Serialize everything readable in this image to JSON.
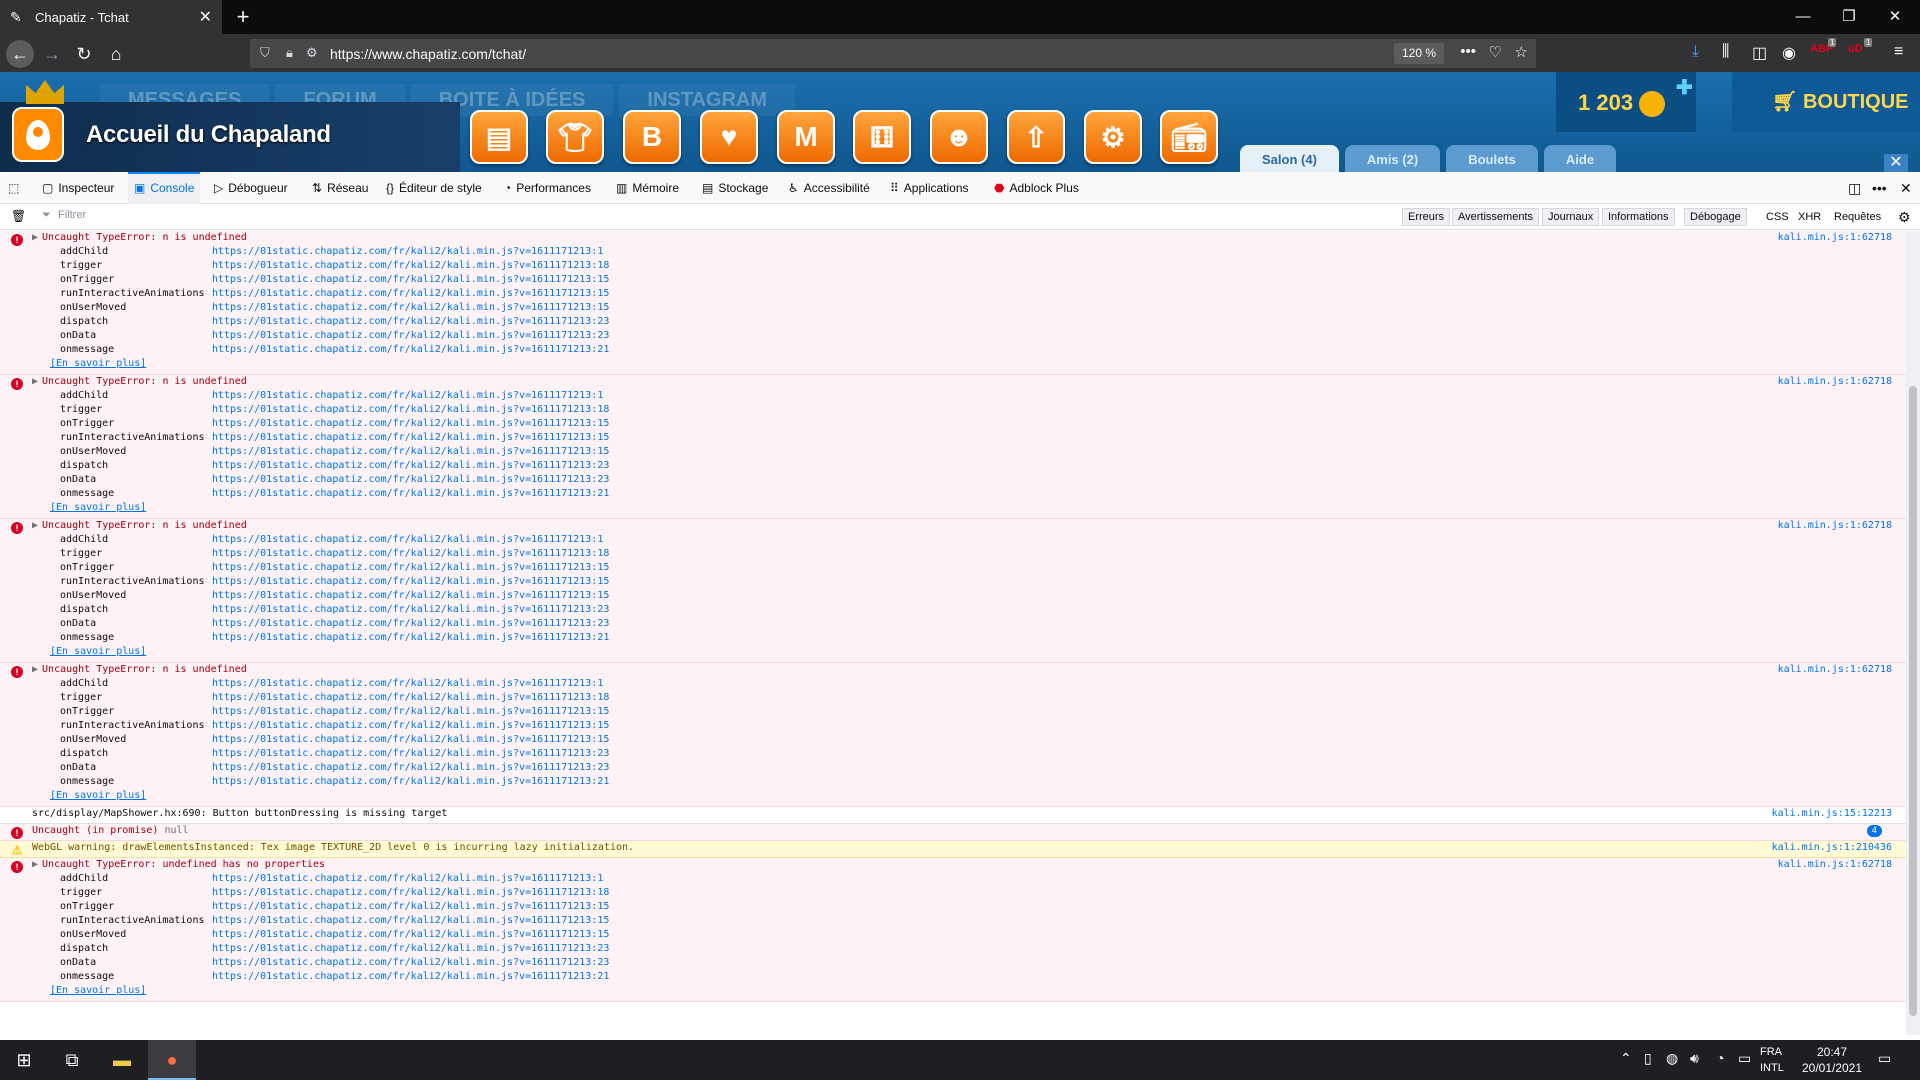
{
  "browser": {
    "tab_title": "Chapatiz - Tchat",
    "url": "https://www.chapatiz.com/tchat/",
    "zoom": "120 %",
    "abp_badge": "1",
    "ud_badge": "1"
  },
  "game": {
    "nav": [
      "MESSAGES",
      "FORUM",
      "BOITE À IDÉES",
      "INSTAGRAM"
    ],
    "home_title": "Accueil du Chapaland",
    "coins": "1 203",
    "shop": "BOUTIQUE",
    "tabs": [
      "Salon (4)",
      "Amis (2)",
      "Boulets",
      "Aide"
    ],
    "buttons": [
      "journal",
      "tshirt",
      "B",
      "heart-bubble",
      "M",
      "dice",
      "character",
      "up-arrow",
      "gear",
      "radio"
    ]
  },
  "devtools": {
    "tabs": [
      "Inspecteur",
      "Console",
      "Débogueur",
      "Réseau",
      "Éditeur de style",
      "Performances",
      "Mémoire",
      "Stockage",
      "Accessibilité",
      "Applications",
      "Adblock Plus"
    ],
    "filter_placeholder": "Filtrer",
    "filters": [
      "Erreurs",
      "Avertissements",
      "Journaux",
      "Informations",
      "Débogage"
    ],
    "extra_filters": [
      "CSS",
      "XHR",
      "Requêtes"
    ]
  },
  "console": {
    "learn_more": "[En savoir plus]",
    "stack": [
      {
        "fn": "addChild",
        "src": "https://01static.chapatiz.com/fr/kali2/kali.min.js?v=1611171213:1"
      },
      {
        "fn": "trigger",
        "src": "https://01static.chapatiz.com/fr/kali2/kali.min.js?v=1611171213:18"
      },
      {
        "fn": "onTrigger",
        "src": "https://01static.chapatiz.com/fr/kali2/kali.min.js?v=1611171213:15"
      },
      {
        "fn": "runInteractiveAnimations",
        "src": "https://01static.chapatiz.com/fr/kali2/kali.min.js?v=1611171213:15"
      },
      {
        "fn": "onUserMoved",
        "src": "https://01static.chapatiz.com/fr/kali2/kali.min.js?v=1611171213:15"
      },
      {
        "fn": "dispatch",
        "src": "https://01static.chapatiz.com/fr/kali2/kali.min.js?v=1611171213:23"
      },
      {
        "fn": "onData",
        "src": "https://01static.chapatiz.com/fr/kali2/kali.min.js?v=1611171213:23"
      },
      {
        "fn": "onmessage",
        "src": "https://01static.chapatiz.com/fr/kali2/kali.min.js?v=1611171213:21"
      }
    ],
    "messages": [
      {
        "type": "err",
        "text": "Uncaught TypeError: n is undefined",
        "loc": "kali.min.js:1:62718",
        "trace": true
      },
      {
        "type": "err",
        "text": "Uncaught TypeError: n is undefined",
        "loc": "kali.min.js:1:62718",
        "trace": true
      },
      {
        "type": "err",
        "text": "Uncaught TypeError: n is undefined",
        "loc": "kali.min.js:1:62718",
        "trace": true
      },
      {
        "type": "err",
        "text": "Uncaught TypeError: n is undefined",
        "loc": "kali.min.js:1:62718",
        "trace": true
      },
      {
        "type": "log",
        "text": "src/display/MapShower.hx:690: Button buttonDressing is missing target",
        "loc": "kali.min.js:15:12213",
        "trace": false
      },
      {
        "type": "err",
        "text": "Uncaught (in promise)",
        "suffix": "null",
        "loc": "",
        "count": "4",
        "trace": false
      },
      {
        "type": "warn",
        "text": "WebGL warning: drawElementsInstanced: Tex image TEXTURE_2D level 0 is incurring lazy initialization.",
        "loc": "kali.min.js:1:210436",
        "trace": false
      },
      {
        "type": "err",
        "text": "Uncaught TypeError: undefined has no properties",
        "loc": "kali.min.js:1:62718",
        "trace": true
      }
    ]
  },
  "taskbar": {
    "lang_top": "FRA",
    "lang_bottom": "INTL",
    "time": "20:47",
    "date": "20/01/2021"
  }
}
